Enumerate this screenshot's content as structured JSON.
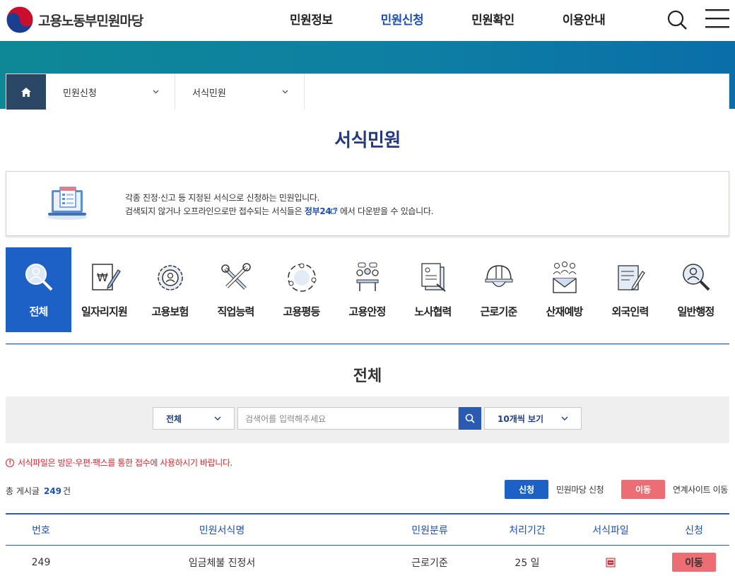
{
  "site": {
    "name": "고용노동부민원마당"
  },
  "nav": {
    "items": [
      "민원정보",
      "민원신청",
      "민원확인",
      "이용안내"
    ],
    "active_index": 1
  },
  "breadcrumb": {
    "level1": "민원신청",
    "level2": "서식민원"
  },
  "page": {
    "title": "서식민원"
  },
  "info": {
    "line1": "각종 진정·신고 등 지정된 서식으로 신청하는 민원입니다.",
    "line2_prefix": "검색되지 않거나 오프라인으로만 접수되는 서식들은",
    "link": "정부24",
    "line2_suffix": "에서 다운받을 수 있습니다."
  },
  "categories": [
    {
      "label": "전체",
      "icon": "magnifier-person-icon"
    },
    {
      "label": "일자리지원",
      "icon": "document-won-icon"
    },
    {
      "label": "고용보험",
      "icon": "gear-person-icon"
    },
    {
      "label": "직업능력",
      "icon": "tools-icon"
    },
    {
      "label": "고용평등",
      "icon": "cycle-people-icon"
    },
    {
      "label": "고용안정",
      "icon": "meeting-icon"
    },
    {
      "label": "노사협력",
      "icon": "documents-icon"
    },
    {
      "label": "근로기준",
      "icon": "helmet-icon"
    },
    {
      "label": "산재예방",
      "icon": "mail-people-icon"
    },
    {
      "label": "외국인력",
      "icon": "form-pen-icon"
    },
    {
      "label": "일반행정",
      "icon": "search-person-icon"
    }
  ],
  "active_category": "전체",
  "section": {
    "title": "전체"
  },
  "search": {
    "scope": "전체",
    "placeholder": "검색어를 입력해주세요",
    "page_size": "10개씩 보기"
  },
  "notice": "서식파일은 방문·우편·팩스를 통한 접수에 사용하시기 바랍니다.",
  "total": {
    "prefix": "총 게시글",
    "count": "249",
    "suffix": "건"
  },
  "legend": {
    "apply_btn": "신청",
    "apply_desc": "민원마당 신청",
    "move_btn": "이동",
    "move_desc": "연계사이트 이동"
  },
  "table": {
    "headers": [
      "번호",
      "민원서식명",
      "민원분류",
      "처리기간",
      "서식파일",
      "신청"
    ],
    "rows": [
      {
        "no": "249",
        "name": "임금체불 진정서",
        "category": "근로기준",
        "period": "25 일",
        "file": "hwp-file-icon",
        "action": "이동"
      }
    ]
  },
  "colors": {
    "primary": "#1e61c6",
    "nav_active": "#1e4fb1",
    "title": "#253a7e",
    "danger": "#d6262e",
    "move_btn": "#ec6d73"
  }
}
